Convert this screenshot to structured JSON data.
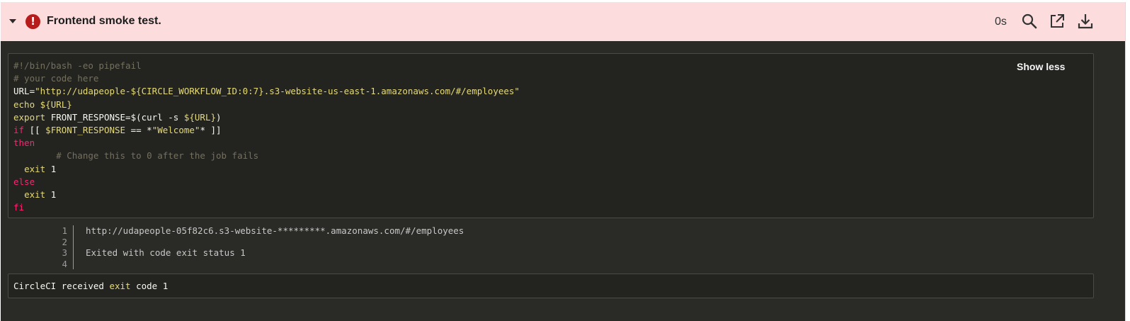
{
  "step": {
    "title": "Frontend smoke test.",
    "duration": "0s",
    "status_color": "#b71c1c",
    "header_bg": "#fcdcdc",
    "icons": {
      "toggle": "caret-down-icon",
      "status": "error-exclamation-icon",
      "search": "search-icon",
      "open": "open-external-icon",
      "download": "download-icon"
    }
  },
  "code": {
    "show_less_label": "Show less",
    "lines": [
      [
        {
          "t": "#!/bin/bash -eo pipefail",
          "c": "comment"
        }
      ],
      [
        {
          "t": "# your code here",
          "c": "comment"
        }
      ],
      [
        {
          "t": "URL=",
          "c": "plain"
        },
        {
          "t": "\"http://udapeople-${CIRCLE_WORKFLOW_ID:0:7}.s3-website-us-east-1.amazonaws.com/#/employees\"",
          "c": "str"
        }
      ],
      [
        {
          "t": "echo ",
          "c": "var"
        },
        {
          "t": "${URL}",
          "c": "var"
        }
      ],
      [
        {
          "t": "export ",
          "c": "var"
        },
        {
          "t": "FRONT_RESPONSE=$(curl -s ",
          "c": "plain"
        },
        {
          "t": "${URL}",
          "c": "var"
        },
        {
          "t": ")",
          "c": "plain"
        }
      ],
      [
        {
          "t": "if",
          "c": "kw"
        },
        {
          "t": " [[ ",
          "c": "plain"
        },
        {
          "t": "$FRONT_RESPONSE",
          "c": "var"
        },
        {
          "t": " == *",
          "c": "plain"
        },
        {
          "t": "\"Welcome\"",
          "c": "str"
        },
        {
          "t": "* ]]",
          "c": "plain"
        }
      ],
      [
        {
          "t": "then",
          "c": "kw"
        }
      ],
      [
        {
          "t": "        # Change this to 0 after the job fails",
          "c": "comment"
        }
      ],
      [
        {
          "t": "  ",
          "c": "plain"
        },
        {
          "t": "exit",
          "c": "var"
        },
        {
          "t": " 1",
          "c": "plain"
        }
      ],
      [
        {
          "t": "else",
          "c": "kw"
        }
      ],
      [
        {
          "t": "  ",
          "c": "plain"
        },
        {
          "t": "exit",
          "c": "var"
        },
        {
          "t": " 1",
          "c": "plain"
        }
      ],
      [
        {
          "t": "fi",
          "c": "kw"
        }
      ]
    ]
  },
  "output": {
    "lines": [
      {
        "num": "1",
        "text": "http://udapeople-05f82c6.s3-website-*********.amazonaws.com/#/employees"
      },
      {
        "num": "2",
        "text": ""
      },
      {
        "num": "3",
        "text": "Exited with code exit status 1"
      },
      {
        "num": "4",
        "text": ""
      }
    ]
  },
  "exit": {
    "prefix": "CircleCI received ",
    "keyword": "exit",
    "suffix": " code 1"
  }
}
